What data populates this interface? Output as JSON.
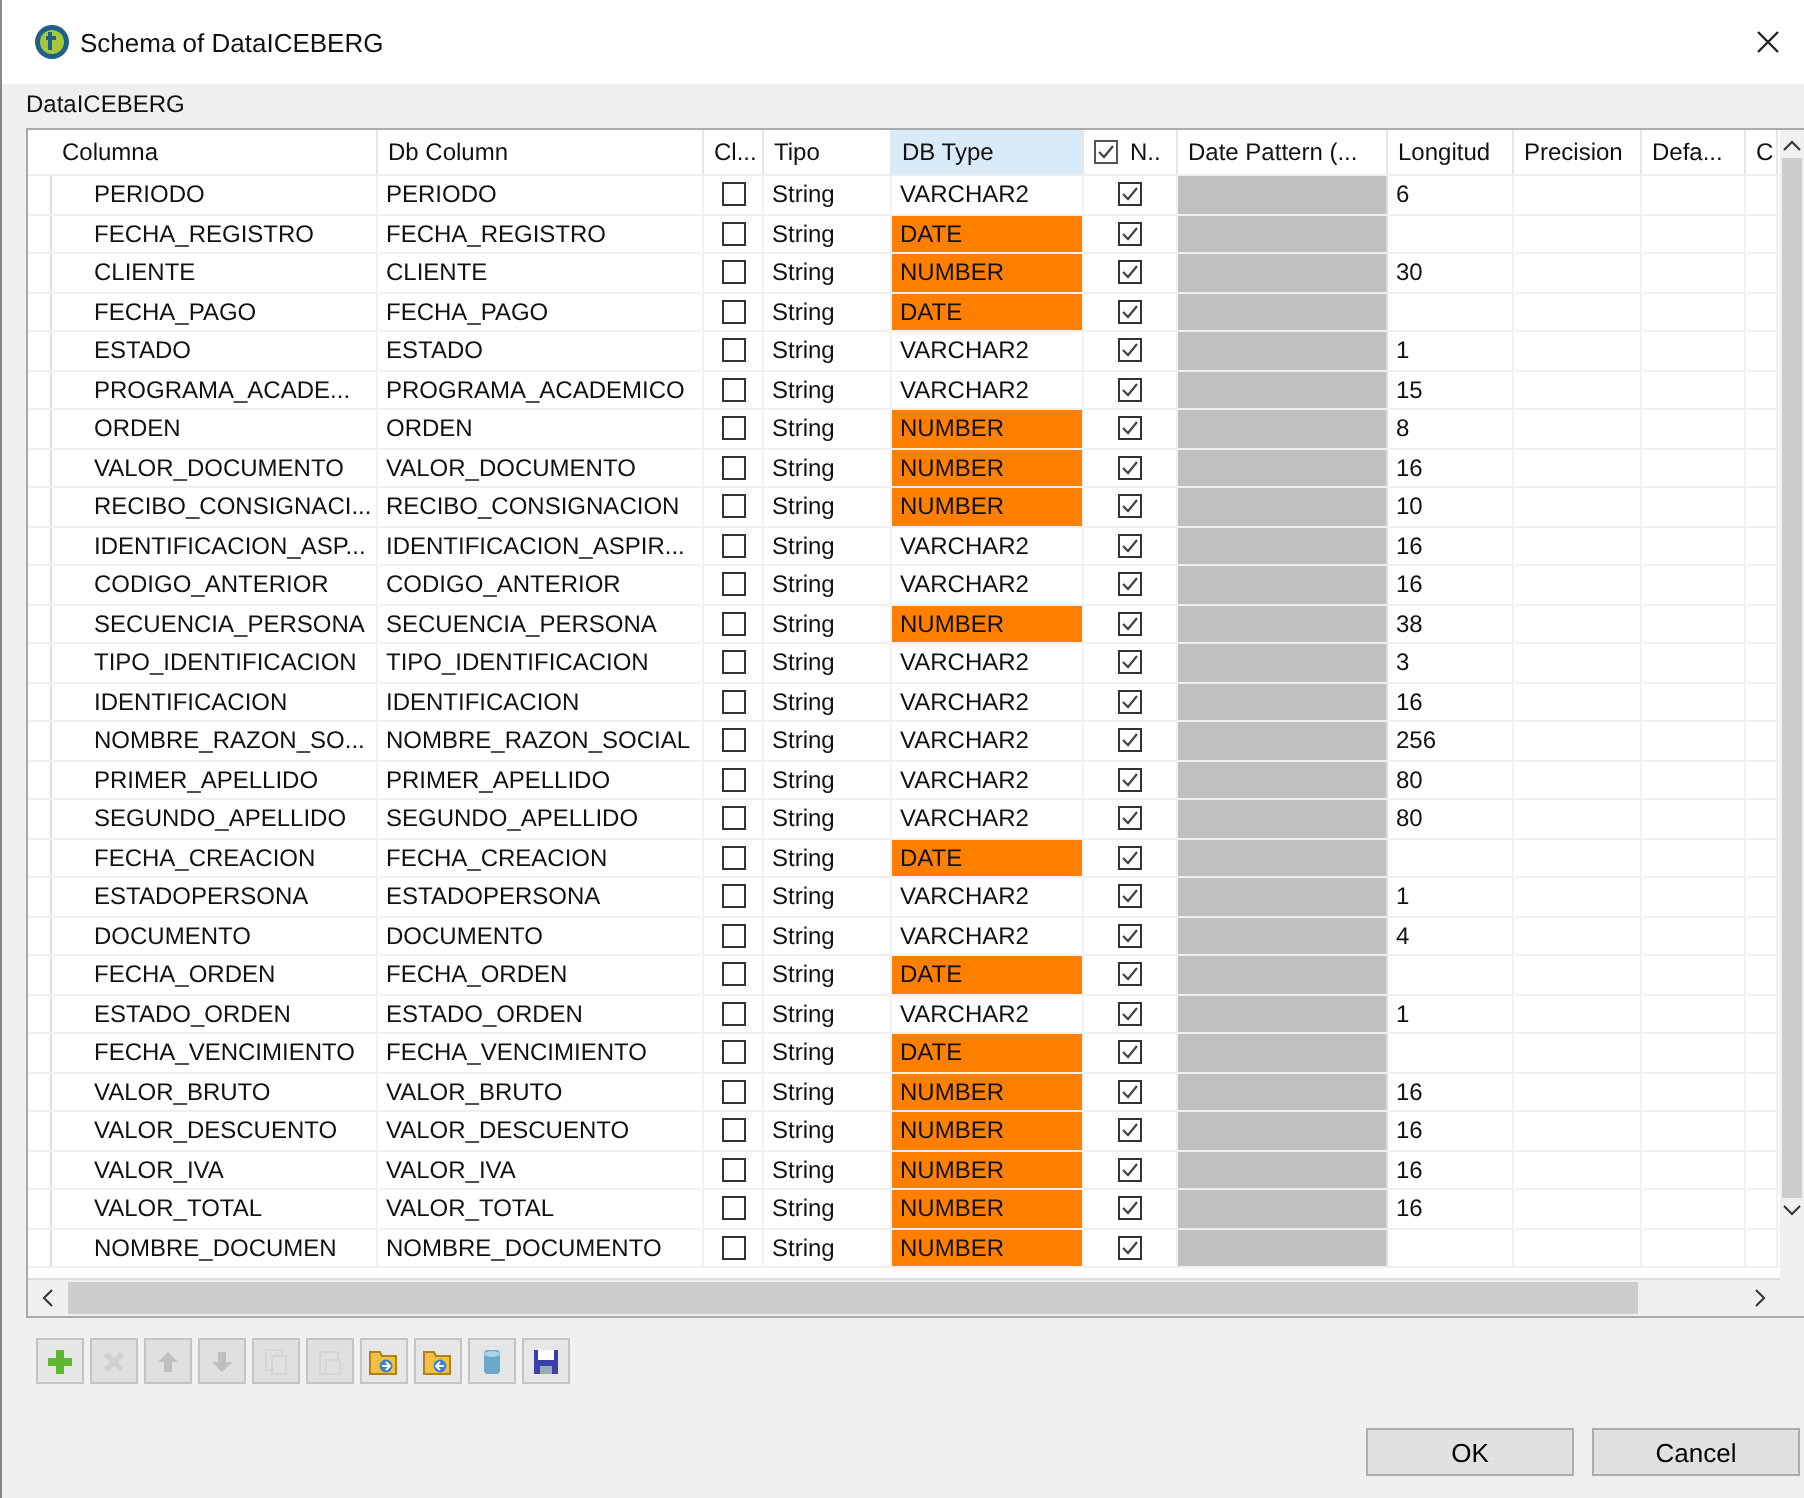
{
  "window": {
    "title": "Schema of DataICEBERG"
  },
  "schema_label": "DataICEBERG",
  "table": {
    "columns": [
      {
        "label": "Columna",
        "selected": false
      },
      {
        "label": "Db Column",
        "selected": false
      },
      {
        "label": "Cl...",
        "selected": false
      },
      {
        "label": "Tipo",
        "selected": false
      },
      {
        "label": "DB Type",
        "selected": true
      },
      {
        "label": "N..",
        "selected": false,
        "checked": true
      },
      {
        "label": "Date Pattern (...",
        "selected": false
      },
      {
        "label": "Longitud",
        "selected": false
      },
      {
        "label": "Precision",
        "selected": false
      },
      {
        "label": "Defa...",
        "selected": false
      },
      {
        "label": "C",
        "selected": false
      }
    ],
    "rows": [
      {
        "columna": "PERIODO",
        "db_column": "PERIODO",
        "key": false,
        "tipo": "String",
        "db_type": "VARCHAR2",
        "highlighted": false,
        "nullable": true,
        "longitud": "6"
      },
      {
        "columna": "FECHA_REGISTRO",
        "db_column": "FECHA_REGISTRO",
        "key": false,
        "tipo": "String",
        "db_type": "DATE",
        "highlighted": true,
        "nullable": true
      },
      {
        "columna": "CLIENTE",
        "db_column": "CLIENTE",
        "key": false,
        "tipo": "String",
        "db_type": "NUMBER",
        "highlighted": true,
        "nullable": true,
        "longitud": "30"
      },
      {
        "columna": "FECHA_PAGO",
        "db_column": "FECHA_PAGO",
        "key": false,
        "tipo": "String",
        "db_type": "DATE",
        "highlighted": true,
        "nullable": true
      },
      {
        "columna": "ESTADO",
        "db_column": "ESTADO",
        "key": false,
        "tipo": "String",
        "db_type": "VARCHAR2",
        "highlighted": false,
        "nullable": true,
        "longitud": "1"
      },
      {
        "columna": "PROGRAMA_ACADE...",
        "db_column": "PROGRAMA_ACADEMICO",
        "key": false,
        "tipo": "String",
        "db_type": "VARCHAR2",
        "highlighted": false,
        "nullable": true,
        "longitud": "15"
      },
      {
        "columna": "ORDEN",
        "db_column": "ORDEN",
        "key": false,
        "tipo": "String",
        "db_type": "NUMBER",
        "highlighted": true,
        "nullable": true,
        "longitud": "8"
      },
      {
        "columna": "VALOR_DOCUMENTO",
        "db_column": "VALOR_DOCUMENTO",
        "key": false,
        "tipo": "String",
        "db_type": "NUMBER",
        "highlighted": true,
        "nullable": true,
        "longitud": "16"
      },
      {
        "columna": "RECIBO_CONSIGNACI...",
        "db_column": "RECIBO_CONSIGNACION",
        "key": false,
        "tipo": "String",
        "db_type": "NUMBER",
        "highlighted": true,
        "nullable": true,
        "longitud": "10"
      },
      {
        "columna": "IDENTIFICACION_ASP...",
        "db_column": "IDENTIFICACION_ASPIR...",
        "key": false,
        "tipo": "String",
        "db_type": "VARCHAR2",
        "highlighted": false,
        "nullable": true,
        "longitud": "16"
      },
      {
        "columna": "CODIGO_ANTERIOR",
        "db_column": "CODIGO_ANTERIOR",
        "key": false,
        "tipo": "String",
        "db_type": "VARCHAR2",
        "highlighted": false,
        "nullable": true,
        "longitud": "16"
      },
      {
        "columna": "SECUENCIA_PERSONA",
        "db_column": "SECUENCIA_PERSONA",
        "key": false,
        "tipo": "String",
        "db_type": "NUMBER",
        "highlighted": true,
        "nullable": true,
        "longitud": "38"
      },
      {
        "columna": "TIPO_IDENTIFICACION",
        "db_column": "TIPO_IDENTIFICACION",
        "key": false,
        "tipo": "String",
        "db_type": "VARCHAR2",
        "highlighted": false,
        "nullable": true,
        "longitud": "3"
      },
      {
        "columna": "IDENTIFICACION",
        "db_column": "IDENTIFICACION",
        "key": false,
        "tipo": "String",
        "db_type": "VARCHAR2",
        "highlighted": false,
        "nullable": true,
        "longitud": "16"
      },
      {
        "columna": "NOMBRE_RAZON_SO...",
        "db_column": "NOMBRE_RAZON_SOCIAL",
        "key": false,
        "tipo": "String",
        "db_type": "VARCHAR2",
        "highlighted": false,
        "nullable": true,
        "longitud": "256"
      },
      {
        "columna": "PRIMER_APELLIDO",
        "db_column": "PRIMER_APELLIDO",
        "key": false,
        "tipo": "String",
        "db_type": "VARCHAR2",
        "highlighted": false,
        "nullable": true,
        "longitud": "80"
      },
      {
        "columna": "SEGUNDO_APELLIDO",
        "db_column": "SEGUNDO_APELLIDO",
        "key": false,
        "tipo": "String",
        "db_type": "VARCHAR2",
        "highlighted": false,
        "nullable": true,
        "longitud": "80"
      },
      {
        "columna": "FECHA_CREACION",
        "db_column": "FECHA_CREACION",
        "key": false,
        "tipo": "String",
        "db_type": "DATE",
        "highlighted": true,
        "nullable": true
      },
      {
        "columna": "ESTADOPERSONA",
        "db_column": "ESTADOPERSONA",
        "key": false,
        "tipo": "String",
        "db_type": "VARCHAR2",
        "highlighted": false,
        "nullable": true,
        "longitud": "1"
      },
      {
        "columna": "DOCUMENTO",
        "db_column": "DOCUMENTO",
        "key": false,
        "tipo": "String",
        "db_type": "VARCHAR2",
        "highlighted": false,
        "nullable": true,
        "longitud": "4"
      },
      {
        "columna": "FECHA_ORDEN",
        "db_column": "FECHA_ORDEN",
        "key": false,
        "tipo": "String",
        "db_type": "DATE",
        "highlighted": true,
        "nullable": true
      },
      {
        "columna": "ESTADO_ORDEN",
        "db_column": "ESTADO_ORDEN",
        "key": false,
        "tipo": "String",
        "db_type": "VARCHAR2",
        "highlighted": false,
        "nullable": true,
        "longitud": "1"
      },
      {
        "columna": "FECHA_VENCIMIENTO",
        "db_column": "FECHA_VENCIMIENTO",
        "key": false,
        "tipo": "String",
        "db_type": "DATE",
        "highlighted": true,
        "nullable": true
      },
      {
        "columna": "VALOR_BRUTO",
        "db_column": "VALOR_BRUTO",
        "key": false,
        "tipo": "String",
        "db_type": "NUMBER",
        "highlighted": true,
        "nullable": true,
        "longitud": "16"
      },
      {
        "columna": "VALOR_DESCUENTO",
        "db_column": "VALOR_DESCUENTO",
        "key": false,
        "tipo": "String",
        "db_type": "NUMBER",
        "highlighted": true,
        "nullable": true,
        "longitud": "16"
      },
      {
        "columna": "VALOR_IVA",
        "db_column": "VALOR_IVA",
        "key": false,
        "tipo": "String",
        "db_type": "NUMBER",
        "highlighted": true,
        "nullable": true,
        "longitud": "16"
      },
      {
        "columna": "VALOR_TOTAL",
        "db_column": "VALOR_TOTAL",
        "key": false,
        "tipo": "String",
        "db_type": "NUMBER",
        "highlighted": true,
        "nullable": true,
        "longitud": "16"
      },
      {
        "columna": "NOMBRE_DOCUMEN",
        "db_column": "NOMBRE_DOCUMENTO",
        "key": false,
        "tipo": "String",
        "db_type": "NUMBER",
        "highlighted": true,
        "nullable": true
      }
    ]
  },
  "toolbar": [
    {
      "kind": "add",
      "disabled": false
    },
    {
      "kind": "remove",
      "disabled": true
    },
    {
      "kind": "up",
      "disabled": true
    },
    {
      "kind": "down",
      "disabled": true
    },
    {
      "kind": "copy",
      "disabled": true
    },
    {
      "kind": "paste",
      "disabled": true
    },
    {
      "kind": "import",
      "disabled": false
    },
    {
      "kind": "export",
      "disabled": false
    },
    {
      "kind": "database",
      "disabled": false
    },
    {
      "kind": "save",
      "disabled": false
    }
  ],
  "buttons": [
    "OK",
    "Cancel"
  ]
}
